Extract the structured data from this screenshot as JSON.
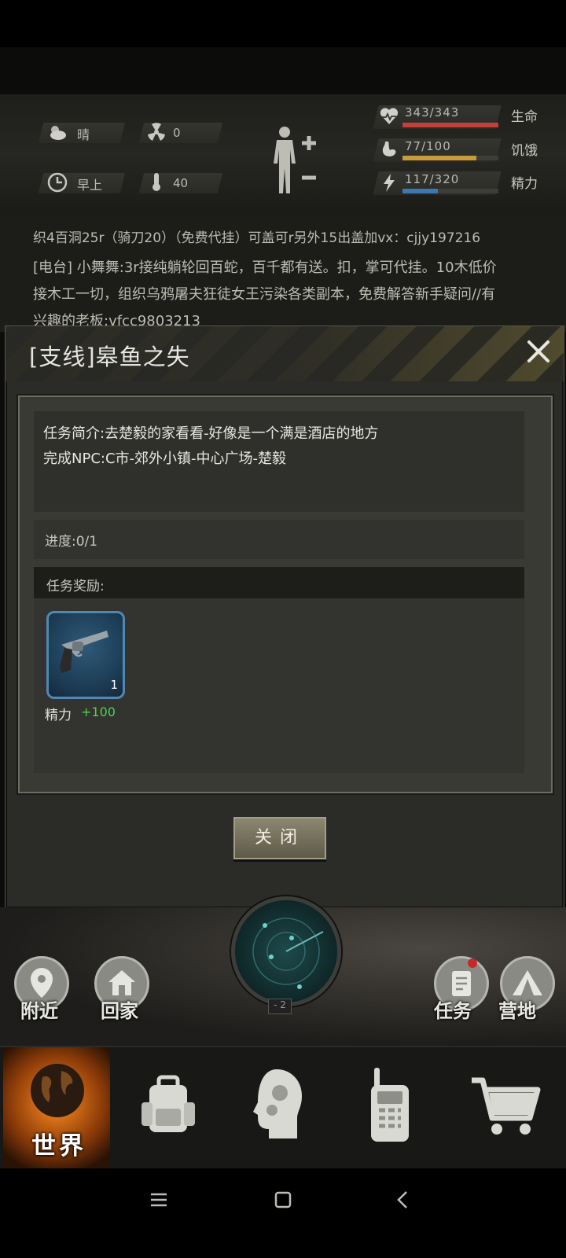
{
  "stats": {
    "weather": "晴",
    "radiation": "0",
    "time_of_day": "早上",
    "temperature": "40",
    "health": {
      "value": "343/343",
      "label": "生命",
      "ratio": 1.0
    },
    "hunger": {
      "value": "77/100",
      "label": "饥饿",
      "ratio": 0.77
    },
    "energy": {
      "value": "117/320",
      "label": "精力",
      "ratio": 0.366
    }
  },
  "chat": {
    "line1": "织4百洞25r（骑刀20）（免费代挂）可盖可r另外15出盖加vx：cjjy197216",
    "line2": "[电台] 小舞舞:3r接纯躺轮回百蛇，百千都有送。扣，掌可代挂。10木低价",
    "line3": "接木工一切，组织乌鸦屠夫狂徒女王污染各类副本，免费解答新手疑问//有",
    "line4": "兴趣的老板:vfcc9803213"
  },
  "dialog": {
    "title": "[支线]皋鱼之失",
    "description": "任务简介:去楚毅的家看看-好像是一个满是酒店的地方",
    "npc": "完成NPC:C市-郊外小镇-中心广场-楚毅",
    "progress": "进度:0/1",
    "reward_header": "任务奖励:",
    "reward_item_qty": "1",
    "reward_stat_name": "精力",
    "reward_stat_value": "+100",
    "close_button": "关闭"
  },
  "map": {
    "nearby": "附近",
    "home": "回家",
    "quest": "任务",
    "camp": "营地",
    "radar_level": "- 2"
  },
  "nav": {
    "world": "世界"
  }
}
